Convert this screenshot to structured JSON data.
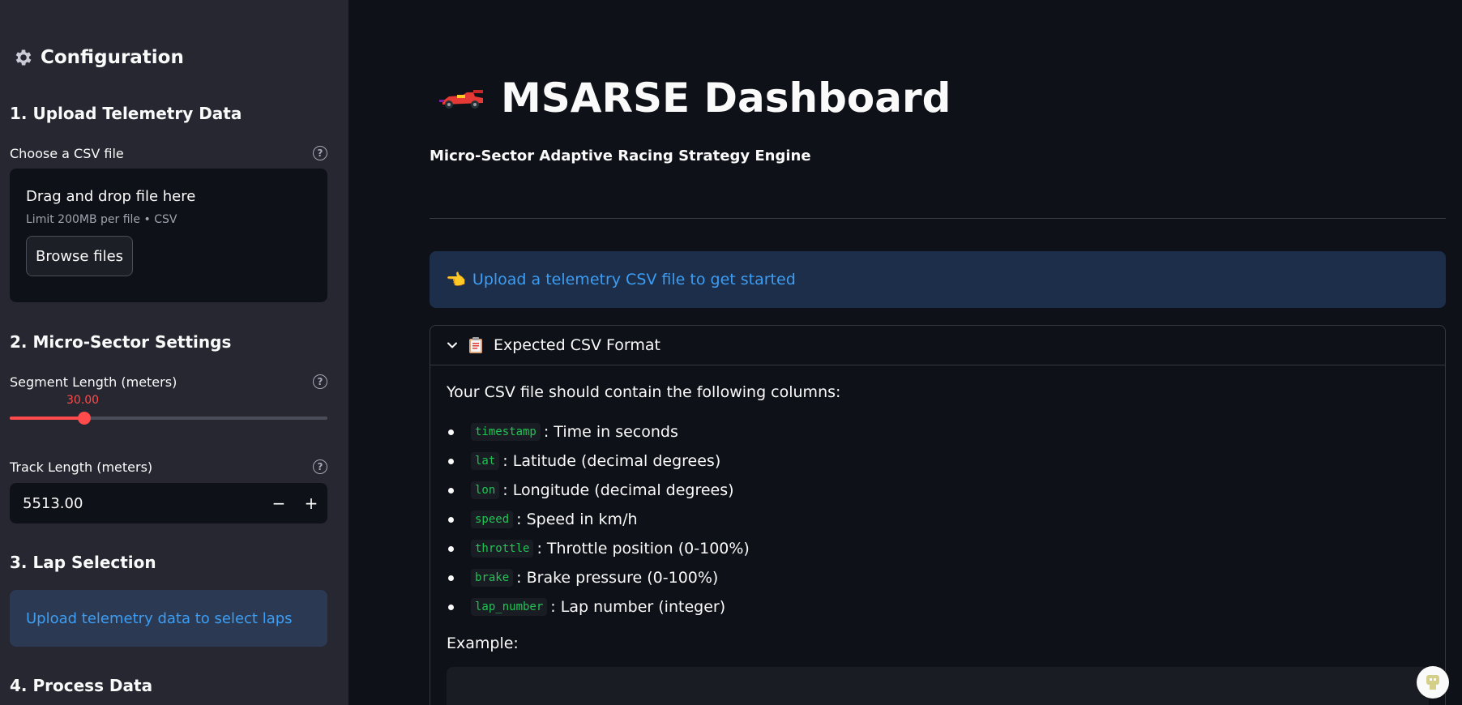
{
  "sidebar": {
    "title": "Configuration",
    "section1": {
      "heading": "1. Upload Telemetry Data",
      "file_label": "Choose a CSV file",
      "dropzone_text": "Drag and drop file here",
      "dropzone_limit": "Limit 200MB per file • CSV",
      "browse_label": "Browse files"
    },
    "section2": {
      "heading": "2. Micro-Sector Settings",
      "segment_label": "Segment Length (meters)",
      "segment_value": "30.00",
      "segment_fraction": 0.235,
      "track_label": "Track Length (meters)",
      "track_value": "5513.00",
      "minus": "−",
      "plus": "+"
    },
    "section3": {
      "heading": "3. Lap Selection",
      "info": "Upload telemetry data to select laps"
    },
    "section4": {
      "heading": "4. Process Data"
    }
  },
  "main": {
    "title": "MSARSE Dashboard",
    "subtitle": "Micro-Sector Adaptive Racing Strategy Engine",
    "info": "Upload a telemetry CSV file to get started",
    "expander": {
      "title": "Expected CSV Format",
      "intro": "Your CSV file should contain the following columns:",
      "columns": [
        {
          "code": "timestamp",
          "desc": ": Time in seconds"
        },
        {
          "code": "lat",
          "desc": ": Latitude (decimal degrees)"
        },
        {
          "code": "lon",
          "desc": ": Longitude (decimal degrees)"
        },
        {
          "code": "speed",
          "desc": ": Speed in km/h"
        },
        {
          "code": "throttle",
          "desc": ": Throttle position (0-100%)"
        },
        {
          "code": "brake",
          "desc": ": Brake pressure (0-100%)"
        },
        {
          "code": "lap_number",
          "desc": ": Lap number (integer)"
        }
      ],
      "example_label": "Example:"
    }
  },
  "colors": {
    "accent": "#ff4b4b",
    "info_text": "#3d9df3",
    "code_text": "#21c354"
  }
}
